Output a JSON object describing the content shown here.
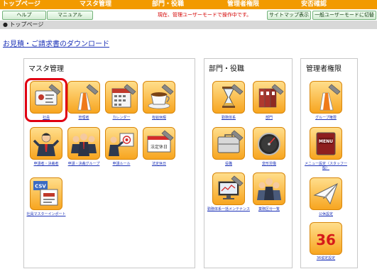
{
  "nav": {
    "top": "トップページ",
    "master": "マスタ管理",
    "dept": "部門・役職",
    "admin": "管理者権限",
    "safety": "安否確認"
  },
  "toolbar": {
    "help": "ヘルプ",
    "manual": "マニュアル",
    "mode_notice": "現在、管理ユーザーモードで操作中です。",
    "sitemap": "サイトマップ表示",
    "switch_user": "一般ユーザーモードに切替"
  },
  "breadcrumb": "● トップページ",
  "download_link": "お見積・ご請求書のダウンロード",
  "panels": {
    "master": {
      "title": "マスタ管理",
      "items": [
        "社員",
        "管理者",
        "カレンダー",
        "有給休暇",
        "申請者・決裁者",
        "申請・決裁グループ",
        "申請ルール",
        "法定休日",
        "社員マスターインポート"
      ]
    },
    "dept": {
      "title": "部門・役職",
      "items": [
        "勤務体系",
        "部門",
        "役職",
        "変形労働",
        "勤務体系一括メンテナンス",
        "業務区分一覧"
      ]
    },
    "admin": {
      "title": "管理者権限",
      "items": [
        "グループ権限",
        "メニュー設定（スタッフ一般）",
        "公休設定",
        "36協定設定"
      ]
    }
  },
  "icon_text": {
    "csv": "CSV",
    "menu": "MENU",
    "thirty_six": "36",
    "calendar_tag": "法定休日"
  }
}
